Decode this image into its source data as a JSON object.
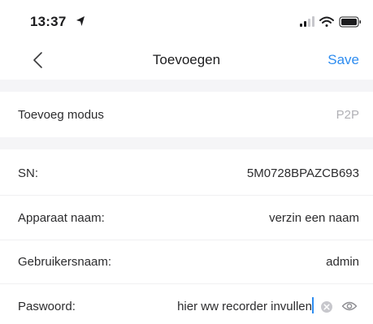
{
  "status_bar": {
    "time": "13:37",
    "icons": [
      "location-arrow-icon",
      "signal-icon",
      "wifi-icon",
      "battery-icon"
    ]
  },
  "nav": {
    "back_icon": "chevron-left-icon",
    "title": "Toevoegen",
    "save_label": "Save"
  },
  "colors": {
    "accent": "#2d8cf0",
    "section_background": "#f5f5f7",
    "muted_value": "#b0b0b5"
  },
  "mode": {
    "label": "Toevoeg modus",
    "value": "P2P"
  },
  "fields": {
    "sn": {
      "label": "SN:",
      "value": "5M0728BPAZCB693"
    },
    "device_name": {
      "label": "Apparaat naam:",
      "value": "verzin een naam"
    },
    "username": {
      "label": "Gebruikersnaam:",
      "value": "admin"
    },
    "password": {
      "label": "Paswoord:",
      "value": "hier ww recorder invullen",
      "icons": [
        "clear-icon",
        "eye-icon"
      ]
    }
  }
}
